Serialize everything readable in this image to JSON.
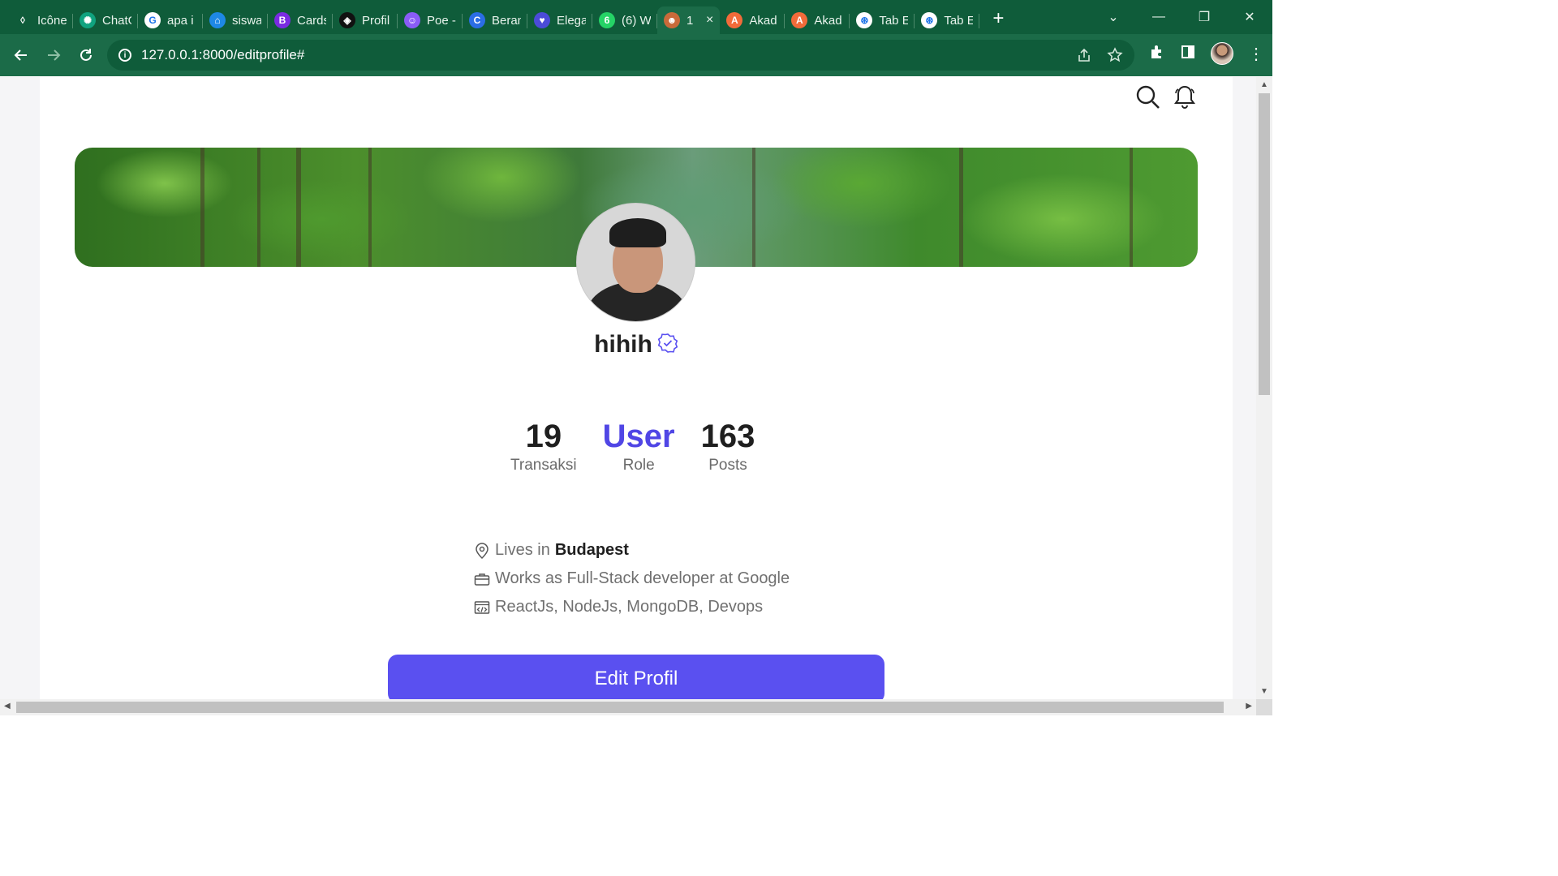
{
  "browser": {
    "tabs": [
      {
        "title": "Icône",
        "fav_color": "#0f5c3a",
        "fav_glyph": "◊"
      },
      {
        "title": "ChatG",
        "fav_color": "#10a37f",
        "fav_glyph": "✺"
      },
      {
        "title": "apa i",
        "fav_color": "#ffffff",
        "fav_glyph": "G"
      },
      {
        "title": "siswa",
        "fav_color": "#1e88e5",
        "fav_glyph": "⌂"
      },
      {
        "title": "Cards",
        "fav_color": "#7a2be2",
        "fav_glyph": "B"
      },
      {
        "title": "Profil",
        "fav_color": "#111111",
        "fav_glyph": "◈"
      },
      {
        "title": "Poe -",
        "fav_color": "#8a5cf6",
        "fav_glyph": "☺"
      },
      {
        "title": "Beran",
        "fav_color": "#2b6de5",
        "fav_glyph": "C"
      },
      {
        "title": "Elega",
        "fav_color": "#4b4bd8",
        "fav_glyph": "♥"
      },
      {
        "title": "(6) W",
        "fav_color": "#25d366",
        "fav_glyph": "6"
      },
      {
        "title": "1",
        "fav_color": "#c96a3a",
        "fav_glyph": "☻",
        "active": true
      },
      {
        "title": "Akad",
        "fav_color": "#f26b3a",
        "fav_glyph": "A"
      },
      {
        "title": "Akad",
        "fav_color": "#f26b3a",
        "fav_glyph": "A"
      },
      {
        "title": "Tab E",
        "fav_color": "#ffffff",
        "fav_glyph": "⊛"
      },
      {
        "title": "Tab E",
        "fav_color": "#ffffff",
        "fav_glyph": "⊛"
      }
    ],
    "new_tab_glyph": "+",
    "close_tab_glyph": "×",
    "url": "127.0.0.1:8000/editprofile#",
    "theme_color": "#0f5c3a"
  },
  "profile": {
    "username": "hihih",
    "verified": true,
    "stats": [
      {
        "value": "19",
        "label": "Transaksi",
        "accent": false
      },
      {
        "value": "User",
        "label": "Role",
        "accent": true
      },
      {
        "value": "163",
        "label": "Posts",
        "accent": false
      }
    ],
    "info": {
      "location_prefix": "Lives in",
      "location": "Budapest",
      "work": "Works as Full-Stack developer at Google",
      "skills": "ReactJs, NodeJs, MongoDB, Devops"
    },
    "edit_button_label": "Edit Profil",
    "accent_color": "#5a50f0"
  }
}
